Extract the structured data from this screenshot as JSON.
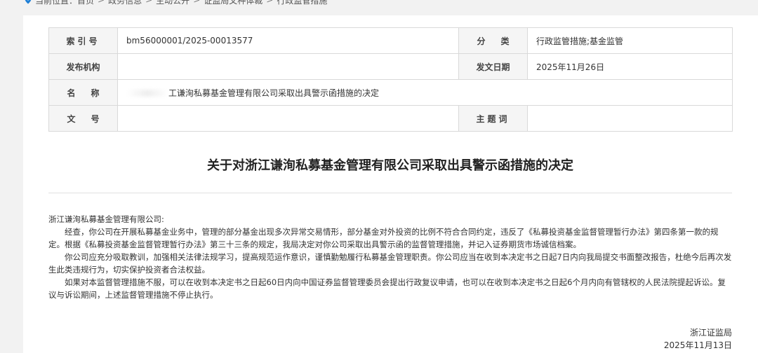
{
  "breadcrumb": {
    "prefix": "当前位置：",
    "items": [
      "首页",
      "政务信息",
      "主动公开",
      "证监局文种体裁",
      "行政监管措施"
    ],
    "separator": ">"
  },
  "meta": {
    "index_label": "索引号",
    "index_value": "bm56000001/2025-00013577",
    "category_label": "分类",
    "category_value": "行政监管措施;基金监管",
    "publisher_label": "发布机构",
    "publisher_value": "",
    "date_label": "发文日期",
    "date_value": "2025年11月26日",
    "name_label": "名称",
    "name_value": "工谦洵私募基金管理有限公司采取出具警示函措施的决定",
    "docno_label": "文号",
    "docno_value": "",
    "subject_label": "主题词",
    "subject_value": ""
  },
  "doc": {
    "title": "关于对浙江谦洵私募基金管理有限公司采取出具警示函措施的决定",
    "addressee": "浙江谦洵私募基金管理有限公司:",
    "paragraphs": [
      "经查，你公司在开展私募基金业务中，管理的部分基金出现多次异常交易情形，部分基金对外投资的比例不符合合同约定，违反了《私募投资基金监督管理暂行办法》第四条第一款的规定。根据《私募投资基金监督管理暂行办法》第三十三条的规定，我局决定对你公司采取出具警示函的监督管理措施，并记入证券期货市场诚信档案。",
      "你公司应充分吸取教训，加强相关法律法规学习，提高规范运作意识，谨慎勤勉履行私募基金管理职责。你公司应当在收到本决定书之日起7日内向我局提交书面整改报告，杜绝今后再次发生此类违规行为，切实保护投资者合法权益。",
      "如果对本监督管理措施不服，可以在收到本决定书之日起60日内向中国证券监督管理委员会提出行政复议申请，也可以在收到本决定书之日起6个月内向有管辖权的人民法院提起诉讼。复议与诉讼期间，上述监督管理措施不停止执行。"
    ],
    "signer": "浙江证监局",
    "sign_date": "2025年11月13日"
  }
}
